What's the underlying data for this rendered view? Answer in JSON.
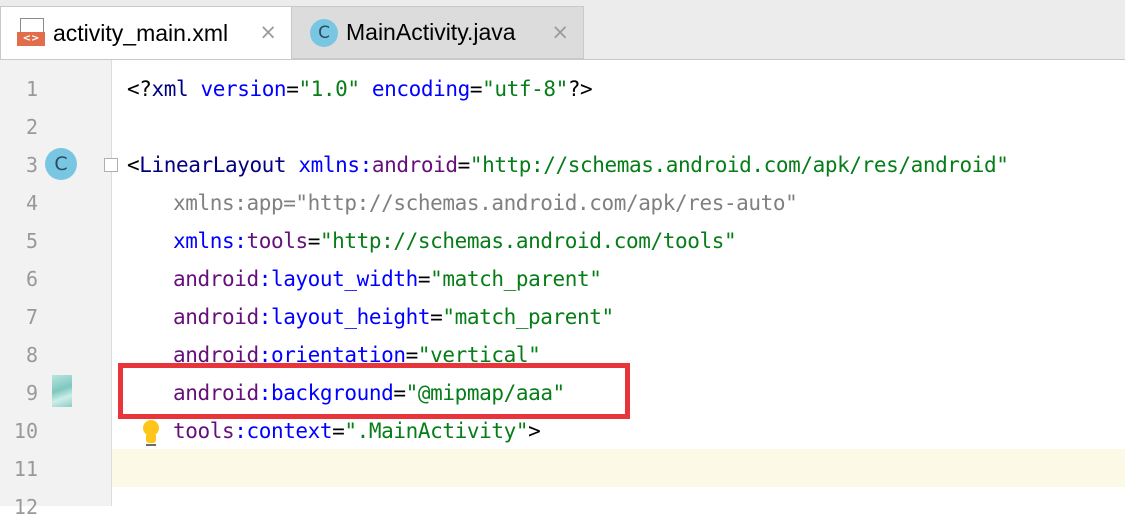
{
  "tabs": [
    {
      "label": "activity_main.xml",
      "icon": "xml-file-icon",
      "active": true
    },
    {
      "label": "MainActivity.java",
      "icon": "java-class-icon",
      "active": false
    }
  ],
  "tab_icons": {
    "xml_badge": "<>",
    "class_letter": "C",
    "close_glyph": "×"
  },
  "line_numbers": [
    "1",
    "2",
    "3",
    "4",
    "5",
    "6",
    "7",
    "8",
    "9",
    "10",
    "11",
    "12"
  ],
  "gutter_icons": {
    "line3": "C",
    "line9": "image-thumbnail-icon",
    "line10": "lightbulb-icon"
  },
  "code": {
    "l1": {
      "open": "<?",
      "tag": "xml",
      "a1": " version",
      "eq1": "=",
      "v1": "\"1.0\"",
      "a2": " encoding",
      "eq2": "=",
      "v2": "\"utf-8\"",
      "close": "?>"
    },
    "l3": {
      "open": "<",
      "tag": "LinearLayout",
      "a1": " xmlns:",
      "a1n": "android",
      "eq": "=",
      "v": "\"http://schemas.android.com/apk/res/android\""
    },
    "l4": {
      "text": "xmlns:app=\"http://schemas.android.com/apk/res-auto\""
    },
    "l5": {
      "a": "xmlns:",
      "an": "tools",
      "eq": "=",
      "v": "\"http://schemas.android.com/tools\""
    },
    "l6": {
      "ns": "android",
      "a": ":layout_width",
      "eq": "=",
      "v": "\"match_parent\""
    },
    "l7": {
      "ns": "android",
      "a": ":layout_height",
      "eq": "=",
      "v": "\"match_parent\""
    },
    "l8": {
      "ns": "android",
      "a": ":orientation",
      "eq": "=",
      "v": "\"vertical\""
    },
    "l9": {
      "ns": "android",
      "a": ":background",
      "eq": "=",
      "v": "\"@mipmap/aaa\""
    },
    "l10": {
      "ns": "tools",
      "a": ":context",
      "eq": "=",
      "v": "\".MainActivity\"",
      "close": ">"
    }
  },
  "colors": {
    "annotation_box": "#e8353b",
    "string": "#067d17",
    "attribute": "#0000ff",
    "namespace": "#660e7a",
    "tag": "#000080",
    "current_line": "#fdf9e7"
  }
}
